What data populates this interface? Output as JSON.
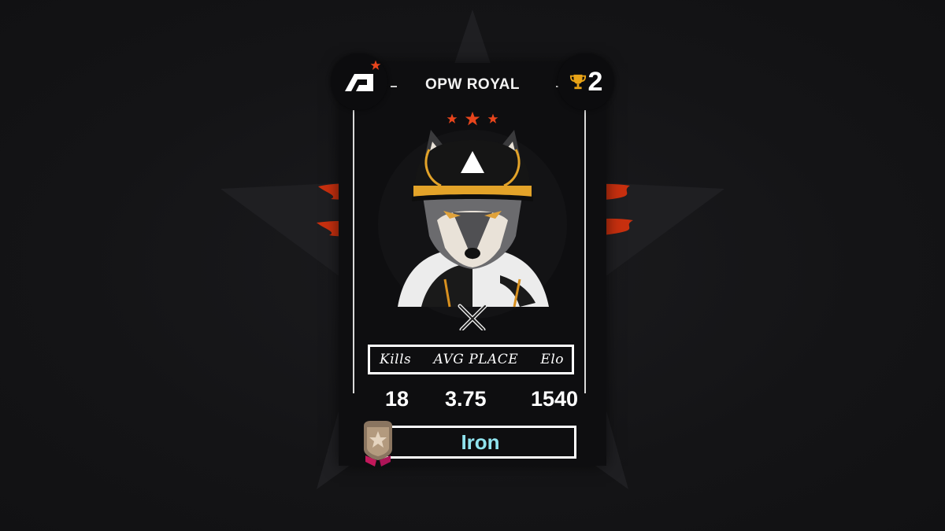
{
  "player": {
    "name": "OPW ROYAL",
    "rank": "2"
  },
  "stats": {
    "kills_label": "Kills",
    "avg_place_label": "AVG PLACE",
    "elo_label": "Elo",
    "kills": "18",
    "avg_place": "3.75",
    "elo": "1540"
  },
  "tier": {
    "label": "Iron"
  },
  "icons": {
    "brand_logo": "astro-logo-icon",
    "trophy": "trophy-icon",
    "crossed_swords": "crossed-swords-icon",
    "tier_badge": "star-badge-icon"
  },
  "colors": {
    "accent": "#e8451c",
    "tier_text": "#8fe3ee",
    "trophy": "#e8a317",
    "card_bg": "#0e0e10"
  },
  "star_rating": 3
}
